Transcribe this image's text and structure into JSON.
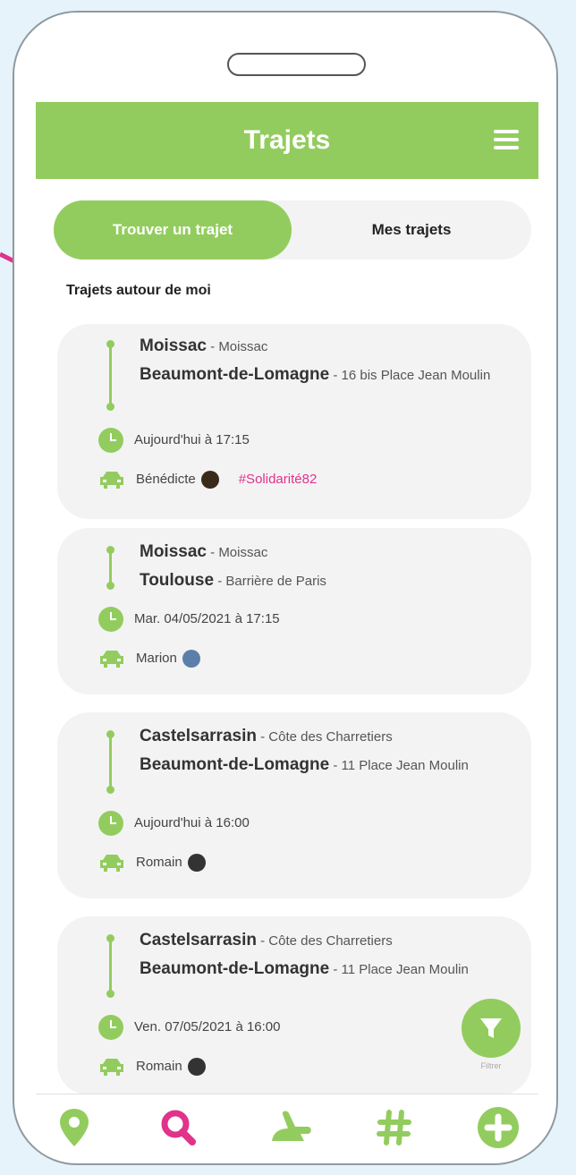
{
  "header": {
    "title": "Trajets"
  },
  "tabs": [
    {
      "label": "Trouver un trajet",
      "active": true
    },
    {
      "label": "Mes trajets",
      "active": false
    }
  ],
  "section_title": "Trajets autour de moi",
  "trips": [
    {
      "from_city": "Moissac",
      "from_place": " - Moissac",
      "to_city": "Beaumont-de-Lomagne",
      "to_place": " - 16 bis Place Jean Moulin",
      "time": "Aujourd'hui à 17:15",
      "driver": "Bénédicte",
      "tag": "#Solidarité82"
    },
    {
      "from_city": "Moissac",
      "from_place": " - Moissac",
      "to_city": "Toulouse",
      "to_place": " - Barrière de Paris",
      "time": "Mar. 04/05/2021 à 17:15",
      "driver": "Marion"
    },
    {
      "from_city": "Castelsarrasin",
      "from_place": " - Côte des Charretiers",
      "to_city": "Beaumont-de-Lomagne",
      "to_place": " - 11 Place Jean Moulin",
      "time": "Aujourd'hui à 16:00",
      "driver": "Romain"
    },
    {
      "from_city": "Castelsarrasin",
      "from_place": " - Côte des Charretiers",
      "to_city": "Beaumont-de-Lomagne",
      "to_place": " - 11 Place Jean Moulin",
      "time": "Ven. 07/05/2021 à 16:00",
      "driver": "Romain"
    }
  ],
  "filter": {
    "label": "Filtrer"
  },
  "nav": [
    {
      "icon": "map-pin-icon"
    },
    {
      "icon": "search-icon",
      "active": true
    },
    {
      "icon": "hitchhike-icon"
    },
    {
      "icon": "hashtag-icon"
    },
    {
      "icon": "add-icon"
    }
  ],
  "colors": {
    "brand": "#93cc5e",
    "accent": "#e0338a"
  }
}
